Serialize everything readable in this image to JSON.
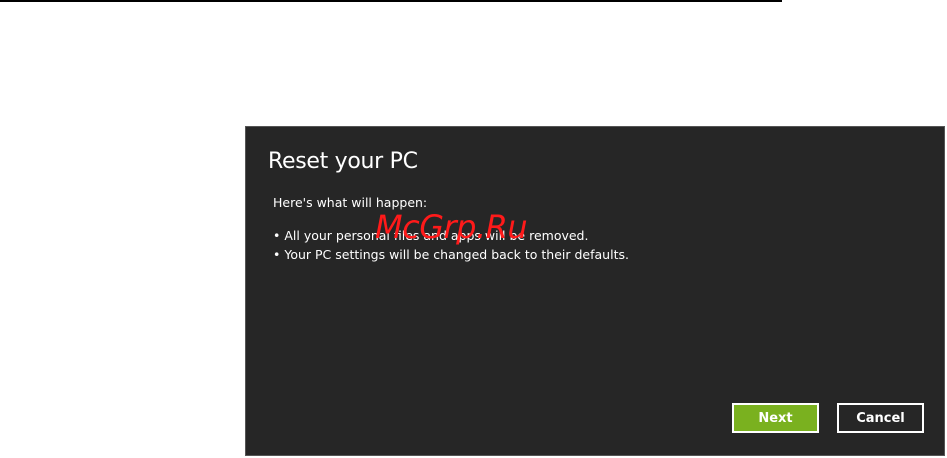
{
  "dialog": {
    "title": "Reset your PC",
    "intro": "Here's what will happen:",
    "bullets": [
      "• All your personal files and apps will be removed.",
      "• Your PC settings will be changed back to their defaults."
    ],
    "buttons": {
      "next_label": "Next",
      "cancel_label": "Cancel"
    }
  },
  "watermark": "McGrp.Ru",
  "colors": {
    "dialog_background": "#262626",
    "accent_button": "#7ab11f",
    "watermark": "#ff1a1a"
  }
}
